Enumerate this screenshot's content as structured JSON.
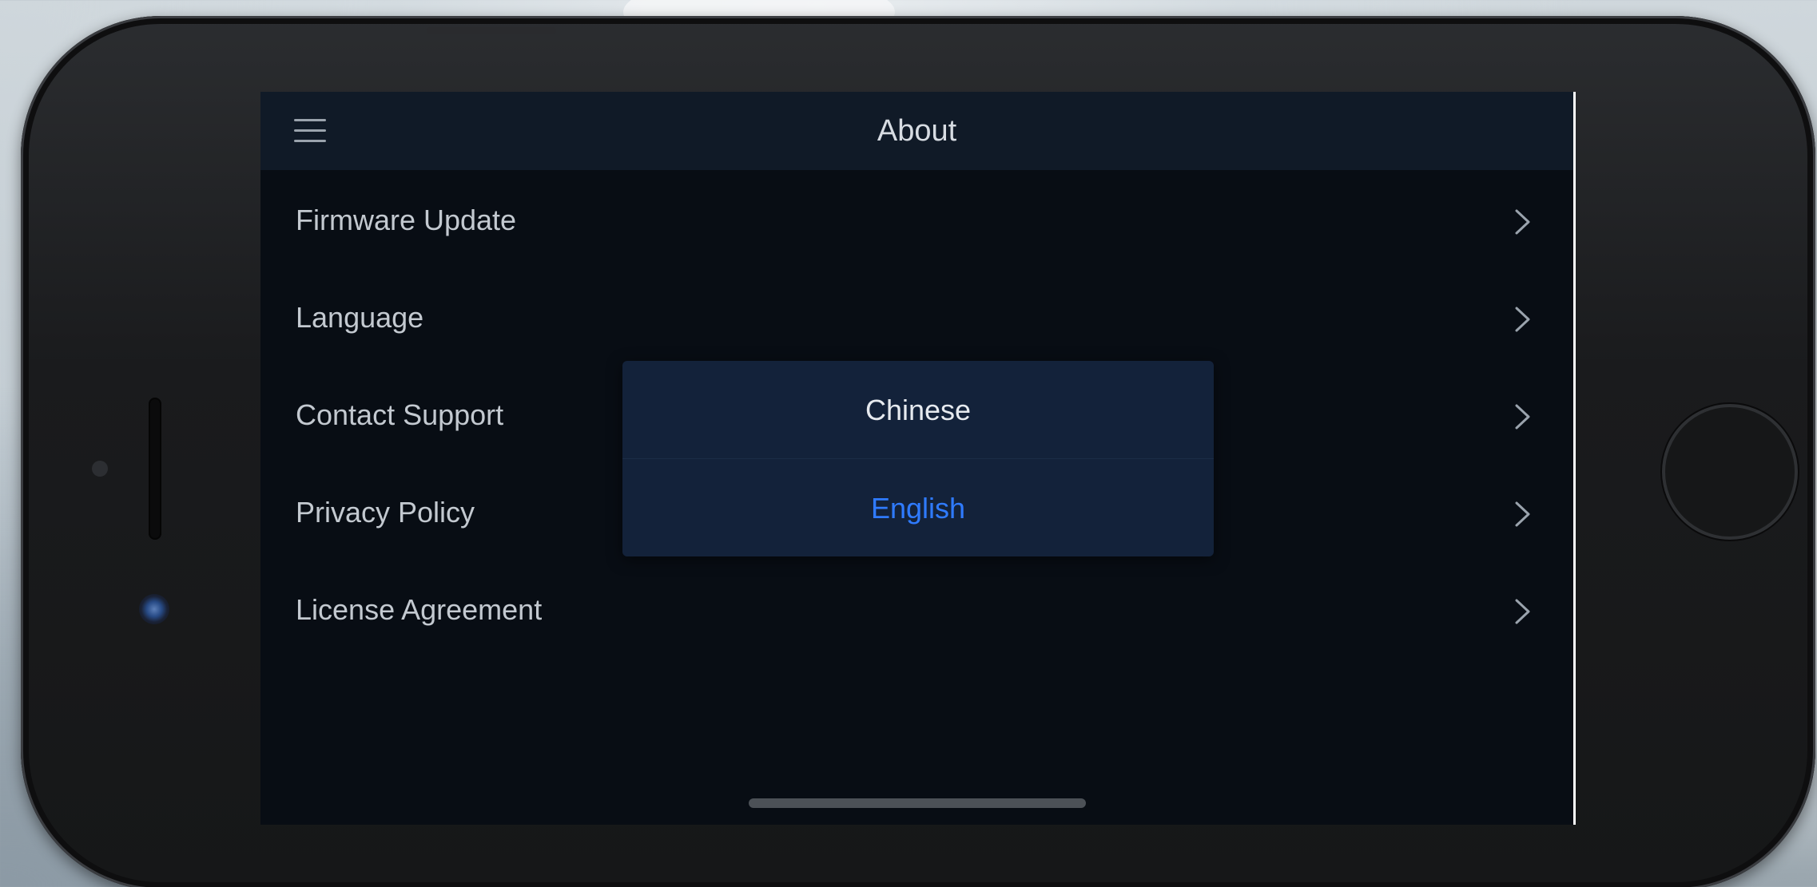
{
  "header": {
    "title": "About",
    "menu_icon": "hamburger-menu-icon"
  },
  "menu": {
    "items": [
      {
        "label": "Firmware Update",
        "icon": "chevron-right-icon"
      },
      {
        "label": "Language",
        "icon": "chevron-right-icon"
      },
      {
        "label": "Contact Support",
        "icon": "chevron-right-icon"
      },
      {
        "label": "Privacy Policy",
        "icon": "chevron-right-icon"
      },
      {
        "label": "License Agreement",
        "icon": "chevron-right-icon"
      }
    ]
  },
  "language_dialog": {
    "options": [
      {
        "label": "Chinese",
        "selected": false,
        "color": "#e6eaef"
      },
      {
        "label": "English",
        "selected": true,
        "color": "#2f7bff"
      }
    ]
  },
  "colors": {
    "screen_bg": "#080d14",
    "header_bg": "#101a27",
    "dialog_bg": "#13223a",
    "accent": "#2f7bff"
  }
}
